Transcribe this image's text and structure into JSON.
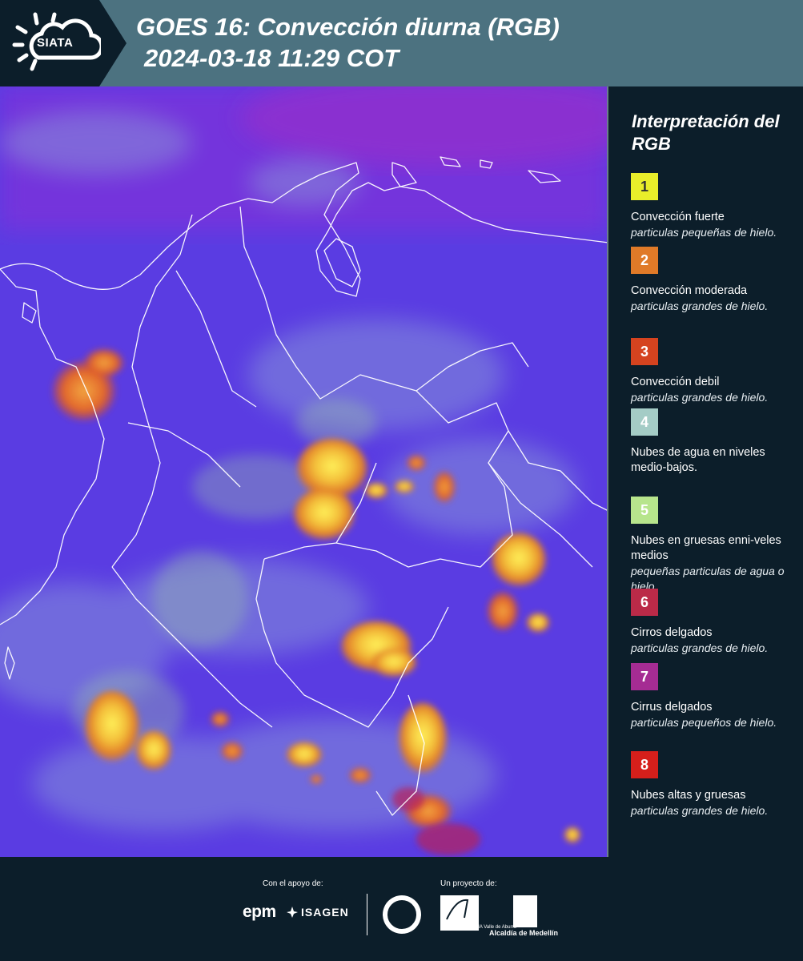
{
  "header": {
    "logo_text": "SIATA",
    "title_line1": "GOES 16: Convección diurna (RGB)",
    "title_line2": "2024-03-18 11:29 COT"
  },
  "legend": {
    "title": "Interpretación del RGB",
    "items": [
      {
        "number": "1",
        "color": "#e9ee2a",
        "number_color": "#333333",
        "label": "Convección fuerte",
        "desc": "particulas pequeñas de hielo."
      },
      {
        "number": "2",
        "color": "#e07a28",
        "number_color": "#ffffff",
        "label": "Convección moderada",
        "desc": "particulas grandes de hielo."
      },
      {
        "number": "3",
        "color": "#d5431f",
        "number_color": "#ffffff",
        "label": "Convección debil",
        "desc": "particulas grandes de hielo."
      },
      {
        "number": "4",
        "color": "#a4ccc6",
        "number_color": "#ffffff",
        "label": "Nubes de agua en niveles medio-bajos.",
        "desc": ""
      },
      {
        "number": "5",
        "color": "#b7e58c",
        "number_color": "#ffffff",
        "label": "Nubes en gruesas enni-veles medios",
        "desc": "pequeñas particulas de agua o hielo."
      },
      {
        "number": "6",
        "color": "#bb2a48",
        "number_color": "#ffffff",
        "label": "Cirros delgados",
        "desc": "particulas grandes de hielo."
      },
      {
        "number": "7",
        "color": "#a52c93",
        "number_color": "#ffffff",
        "label": "Cirrus delgados",
        "desc": "particulas pequeños de hielo."
      },
      {
        "number": "8",
        "color": "#d61f1b",
        "number_color": "#ffffff",
        "label": "Nubes altas y gruesas",
        "desc": "particulas grandes de hielo."
      }
    ]
  },
  "footer": {
    "support_label": "Con el apoyo de:",
    "project_label": "Un proyecto de:",
    "sponsors": [
      "epm",
      "ISAGEN"
    ],
    "partners": {
      "area": "METROPOLITANA Valle de Aburrá",
      "alcaldia": "Alcaldía de Medellín"
    }
  },
  "colors": {
    "header_bg": "#4c7280",
    "dark_bg": "#0c1e2a",
    "map_base": "#5b3ae0"
  }
}
